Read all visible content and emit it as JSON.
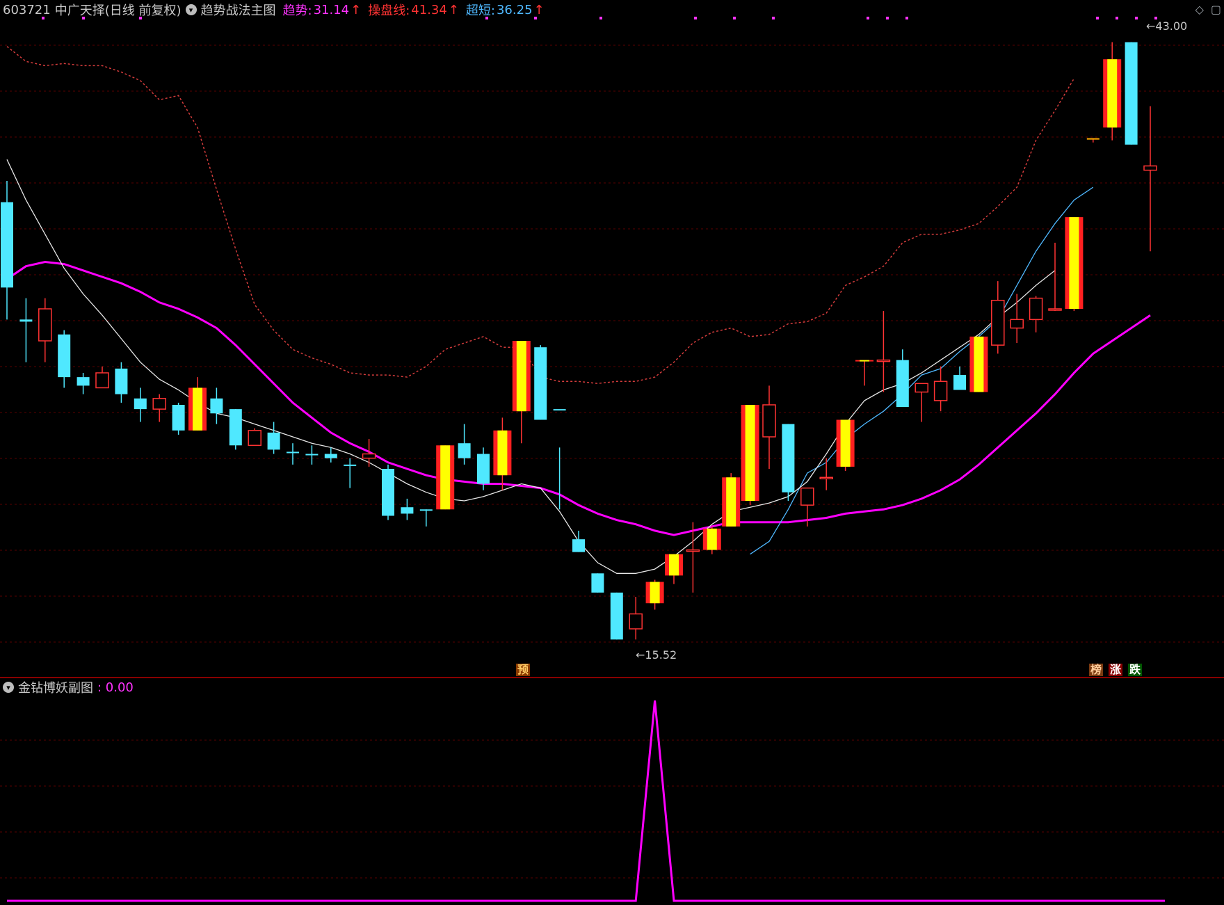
{
  "header": {
    "stock_code": "603721",
    "stock_name": "中广天择(日线 前复权)",
    "indicator_name": "趋势战法主图",
    "label1": "趋势:",
    "value1": "31.14",
    "label2": "操盘线:",
    "value2": "41.34",
    "label3": "超短:",
    "value3": "36.25",
    "color1": "#ff33ff",
    "color2": "#ff3333",
    "color3": "#4fb8ff",
    "arrow_up": "↑"
  },
  "price_labels": {
    "high": "43.00",
    "low": "15.52",
    "low_arrow": "←"
  },
  "tags": {
    "yu": "预",
    "bang": "榜",
    "zhang": "涨",
    "die": "跌"
  },
  "sub_chart": {
    "title": "金钻博妖副图",
    "value_label": ": 0.00"
  },
  "chart_data": {
    "type": "candlestick",
    "price_range": [
      14.0,
      44.0
    ],
    "candles": [
      {
        "o": 31.5,
        "h": 36.5,
        "l": 30.0,
        "c": 35.5,
        "color": "cyan"
      },
      {
        "o": 30.0,
        "h": 31.0,
        "l": 28.0,
        "c": 29.9,
        "color": "cyan"
      },
      {
        "o": 29.0,
        "h": 31.0,
        "l": 28.0,
        "c": 30.5,
        "color": "red"
      },
      {
        "o": 29.3,
        "h": 29.5,
        "l": 26.8,
        "c": 27.3,
        "color": "cyan"
      },
      {
        "o": 27.3,
        "h": 27.5,
        "l": 26.5,
        "c": 26.9,
        "color": "cyan"
      },
      {
        "o": 26.8,
        "h": 27.8,
        "l": 26.8,
        "c": 27.5,
        "color": "red"
      },
      {
        "o": 27.7,
        "h": 28.0,
        "l": 26.1,
        "c": 26.5,
        "color": "cyan"
      },
      {
        "o": 26.3,
        "h": 26.8,
        "l": 25.2,
        "c": 25.8,
        "color": "cyan"
      },
      {
        "o": 25.8,
        "h": 26.5,
        "l": 25.2,
        "c": 26.3,
        "color": "red"
      },
      {
        "o": 26.0,
        "h": 26.1,
        "l": 24.6,
        "c": 24.8,
        "color": "cyan"
      },
      {
        "o": 24.8,
        "h": 27.3,
        "l": 24.8,
        "c": 26.8,
        "color": "yellow"
      },
      {
        "o": 26.3,
        "h": 26.8,
        "l": 25.1,
        "c": 25.6,
        "color": "cyan"
      },
      {
        "o": 25.8,
        "h": 25.8,
        "l": 23.9,
        "c": 24.1,
        "color": "cyan"
      },
      {
        "o": 24.1,
        "h": 24.9,
        "l": 24.1,
        "c": 24.8,
        "color": "red"
      },
      {
        "o": 24.7,
        "h": 25.2,
        "l": 23.7,
        "c": 23.9,
        "color": "cyan"
      },
      {
        "o": 23.8,
        "h": 24.2,
        "l": 23.2,
        "c": 23.8,
        "color": "cyan"
      },
      {
        "o": 23.7,
        "h": 24.1,
        "l": 23.2,
        "c": 23.7,
        "color": "cyan"
      },
      {
        "o": 23.7,
        "h": 24.0,
        "l": 23.3,
        "c": 23.5,
        "color": "cyan"
      },
      {
        "o": 23.2,
        "h": 23.5,
        "l": 22.1,
        "c": 23.2,
        "color": "cyan"
      },
      {
        "o": 23.5,
        "h": 24.4,
        "l": 23.1,
        "c": 23.7,
        "color": "red"
      },
      {
        "o": 23.0,
        "h": 23.2,
        "l": 20.6,
        "c": 20.8,
        "color": "cyan"
      },
      {
        "o": 21.2,
        "h": 21.6,
        "l": 20.6,
        "c": 20.9,
        "color": "cyan"
      },
      {
        "o": 21.1,
        "h": 21.1,
        "l": 20.3,
        "c": 21.1,
        "color": "cyan"
      },
      {
        "o": 21.1,
        "h": 24.1,
        "l": 21.1,
        "c": 24.1,
        "color": "yellow"
      },
      {
        "o": 24.2,
        "h": 25.1,
        "l": 23.2,
        "c": 23.5,
        "color": "cyan"
      },
      {
        "o": 23.7,
        "h": 24.0,
        "l": 22.0,
        "c": 22.3,
        "color": "cyan"
      },
      {
        "o": 22.7,
        "h": 25.4,
        "l": 22.0,
        "c": 24.8,
        "color": "yellow"
      },
      {
        "o": 25.7,
        "h": 29.0,
        "l": 24.2,
        "c": 29.0,
        "color": "yellow"
      },
      {
        "o": 28.7,
        "h": 28.8,
        "l": 25.3,
        "c": 25.3,
        "color": "cyan"
      },
      {
        "o": 25.8,
        "h": 24.0,
        "l": 21.1,
        "c": 25.8,
        "color": "cyan"
      },
      {
        "o": 19.7,
        "h": 20.1,
        "l": 19.1,
        "c": 19.1,
        "color": "cyan"
      },
      {
        "o": 18.1,
        "h": 18.1,
        "l": 17.2,
        "c": 17.2,
        "color": "cyan"
      },
      {
        "o": 17.2,
        "h": 17.2,
        "l": 15.0,
        "c": 15.0,
        "color": "cyan"
      },
      {
        "o": 15.5,
        "h": 17.0,
        "l": 15.0,
        "c": 16.2,
        "color": "red"
      },
      {
        "o": 16.7,
        "h": 17.8,
        "l": 16.4,
        "c": 17.7,
        "color": "yellow"
      },
      {
        "o": 18.0,
        "h": 19.0,
        "l": 17.6,
        "c": 19.0,
        "color": "yellow"
      },
      {
        "o": 19.2,
        "h": 20.5,
        "l": 17.2,
        "c": 19.2,
        "color": "red"
      },
      {
        "o": 19.2,
        "h": 20.3,
        "l": 19.0,
        "c": 20.2,
        "color": "yellow"
      },
      {
        "o": 20.3,
        "h": 22.8,
        "l": 20.3,
        "c": 22.6,
        "color": "yellow"
      },
      {
        "o": 21.5,
        "h": 26.0,
        "l": 21.3,
        "c": 26.0,
        "color": "yellow"
      },
      {
        "o": 24.5,
        "h": 26.9,
        "l": 23.0,
        "c": 26.0,
        "color": "red"
      },
      {
        "o": 25.1,
        "h": 25.1,
        "l": 21.5,
        "c": 21.9,
        "color": "cyan"
      },
      {
        "o": 21.3,
        "h": 22.1,
        "l": 20.3,
        "c": 22.1,
        "color": "red"
      },
      {
        "o": 22.6,
        "h": 23.5,
        "l": 22.0,
        "c": 22.6,
        "color": "red"
      },
      {
        "o": 23.1,
        "h": 25.3,
        "l": 22.9,
        "c": 25.3,
        "color": "yellow"
      },
      {
        "o": 28.1,
        "h": 28.1,
        "l": 26.9,
        "c": 28.1,
        "color": "yellow"
      },
      {
        "o": 28.1,
        "h": 30.4,
        "l": 26.6,
        "c": 28.1,
        "color": "red"
      },
      {
        "o": 28.1,
        "h": 28.6,
        "l": 26.2,
        "c": 25.9,
        "color": "cyan"
      },
      {
        "o": 26.6,
        "h": 26.9,
        "l": 25.2,
        "c": 27.0,
        "color": "red"
      },
      {
        "o": 26.2,
        "h": 27.8,
        "l": 25.7,
        "c": 27.1,
        "color": "red"
      },
      {
        "o": 27.4,
        "h": 27.8,
        "l": 26.9,
        "c": 26.7,
        "color": "cyan"
      },
      {
        "o": 26.6,
        "h": 29.2,
        "l": 26.6,
        "c": 29.2,
        "color": "yellow"
      },
      {
        "o": 28.8,
        "h": 31.8,
        "l": 28.4,
        "c": 30.9,
        "color": "red"
      },
      {
        "o": 29.6,
        "h": 31.2,
        "l": 28.9,
        "c": 30.0,
        "color": "red"
      },
      {
        "o": 30.0,
        "h": 31.1,
        "l": 29.4,
        "c": 31.0,
        "color": "red"
      },
      {
        "o": 30.5,
        "h": 33.6,
        "l": 30.4,
        "c": 30.5,
        "color": "red"
      },
      {
        "o": 30.5,
        "h": 34.8,
        "l": 30.4,
        "c": 34.8,
        "color": "yellow"
      },
      {
        "o": 38.5,
        "h": 38.5,
        "l": 38.3,
        "c": 38.4,
        "color": "orange"
      },
      {
        "o": 39.0,
        "h": 43.0,
        "l": 38.4,
        "c": 42.2,
        "color": "yellow"
      },
      {
        "o": 43.0,
        "h": 43.0,
        "l": 38.2,
        "c": 38.2,
        "color": "cyan"
      },
      {
        "o": 37.2,
        "h": 40.0,
        "l": 33.2,
        "c": 37.0,
        "color": "red"
      }
    ],
    "series": [
      {
        "name": "趋势",
        "color": "#ff00ff",
        "values": [
          31.9,
          32.5,
          32.7,
          32.6,
          32.3,
          32.0,
          31.7,
          31.3,
          30.8,
          30.5,
          30.1,
          29.6,
          28.8,
          27.9,
          27.0,
          26.1,
          25.4,
          24.7,
          24.2,
          23.8,
          23.3,
          23.0,
          22.7,
          22.5,
          22.4,
          22.3,
          22.3,
          22.2,
          22.1,
          21.8,
          21.3,
          20.9,
          20.6,
          20.4,
          20.1,
          19.9,
          20.1,
          20.3,
          20.5,
          20.5,
          20.5,
          20.5,
          20.6,
          20.7,
          20.9,
          21.0,
          21.1,
          21.3,
          21.6,
          22.0,
          22.5,
          23.2,
          24.0,
          24.8,
          25.6,
          26.5,
          27.5,
          28.4,
          29.0,
          29.6,
          30.2
        ]
      },
      {
        "name": "操盘线",
        "color": "#d43c3c",
        "values": [
          42.8,
          42.1,
          41.9,
          42.0,
          41.9,
          41.9,
          41.6,
          41.2,
          40.3,
          40.5,
          39.0,
          36.1,
          33.3,
          30.7,
          29.5,
          28.6,
          28.2,
          27.9,
          27.5,
          27.4,
          27.4,
          27.3,
          27.8,
          28.6,
          28.9,
          29.2,
          28.7,
          28.7,
          27.3,
          27.1,
          27.1,
          27.0,
          27.1,
          27.1,
          27.3,
          28.0,
          28.9,
          29.4,
          29.6,
          29.2,
          29.3,
          29.8,
          29.9,
          30.3,
          31.6,
          32.0,
          32.5,
          33.6,
          34.0,
          34.0,
          34.2,
          34.5,
          35.3,
          36.2,
          38.4,
          39.8,
          41.3
        ]
      },
      {
        "name": "超短",
        "color": "#4fb8ff",
        "values": [
          null,
          null,
          null,
          null,
          null,
          null,
          null,
          null,
          null,
          null,
          null,
          null,
          null,
          null,
          null,
          null,
          null,
          null,
          null,
          null,
          null,
          null,
          null,
          null,
          null,
          null,
          null,
          null,
          null,
          null,
          null,
          null,
          null,
          null,
          null,
          null,
          null,
          null,
          null,
          19.0,
          19.6,
          21.1,
          22.8,
          23.3,
          24.4,
          25.1,
          25.7,
          26.5,
          27.4,
          27.7,
          28.5,
          29.2,
          30.0,
          31.6,
          33.2,
          34.5,
          35.6,
          36.2
        ]
      },
      {
        "name": "MA",
        "color": "#e6e6e6",
        "values": [
          37.5,
          35.6,
          34.0,
          32.4,
          31.2,
          30.2,
          29.1,
          28.0,
          27.2,
          26.7,
          26.1,
          25.6,
          25.4,
          25.1,
          24.8,
          24.5,
          24.2,
          24.0,
          23.7,
          23.3,
          22.8,
          22.3,
          21.9,
          21.6,
          21.5,
          21.7,
          22.0,
          22.3,
          22.1,
          21.0,
          19.6,
          18.6,
          18.1,
          18.1,
          18.3,
          18.9,
          19.6,
          20.4,
          21.0,
          21.2,
          21.4,
          21.7,
          22.4,
          23.7,
          25.1,
          26.2,
          26.7,
          27.0,
          27.5,
          28.1,
          28.7,
          29.3,
          30.1,
          30.8,
          31.6,
          32.3
        ]
      }
    ],
    "sub": {
      "type": "line",
      "name": "金钻博妖副图",
      "values": [
        0,
        0,
        0,
        0,
        0,
        0,
        0,
        0,
        0,
        0,
        0,
        0,
        0,
        0,
        0,
        0,
        0,
        0,
        0,
        0,
        0,
        0,
        0,
        0,
        0,
        0,
        0,
        0,
        0,
        0,
        0,
        0,
        0,
        0,
        1,
        0,
        0,
        0,
        0,
        0,
        0,
        0,
        0,
        0,
        0,
        0,
        0,
        0,
        0,
        0,
        0,
        0,
        0,
        0,
        0,
        0,
        0,
        0,
        0,
        0,
        0
      ]
    }
  }
}
